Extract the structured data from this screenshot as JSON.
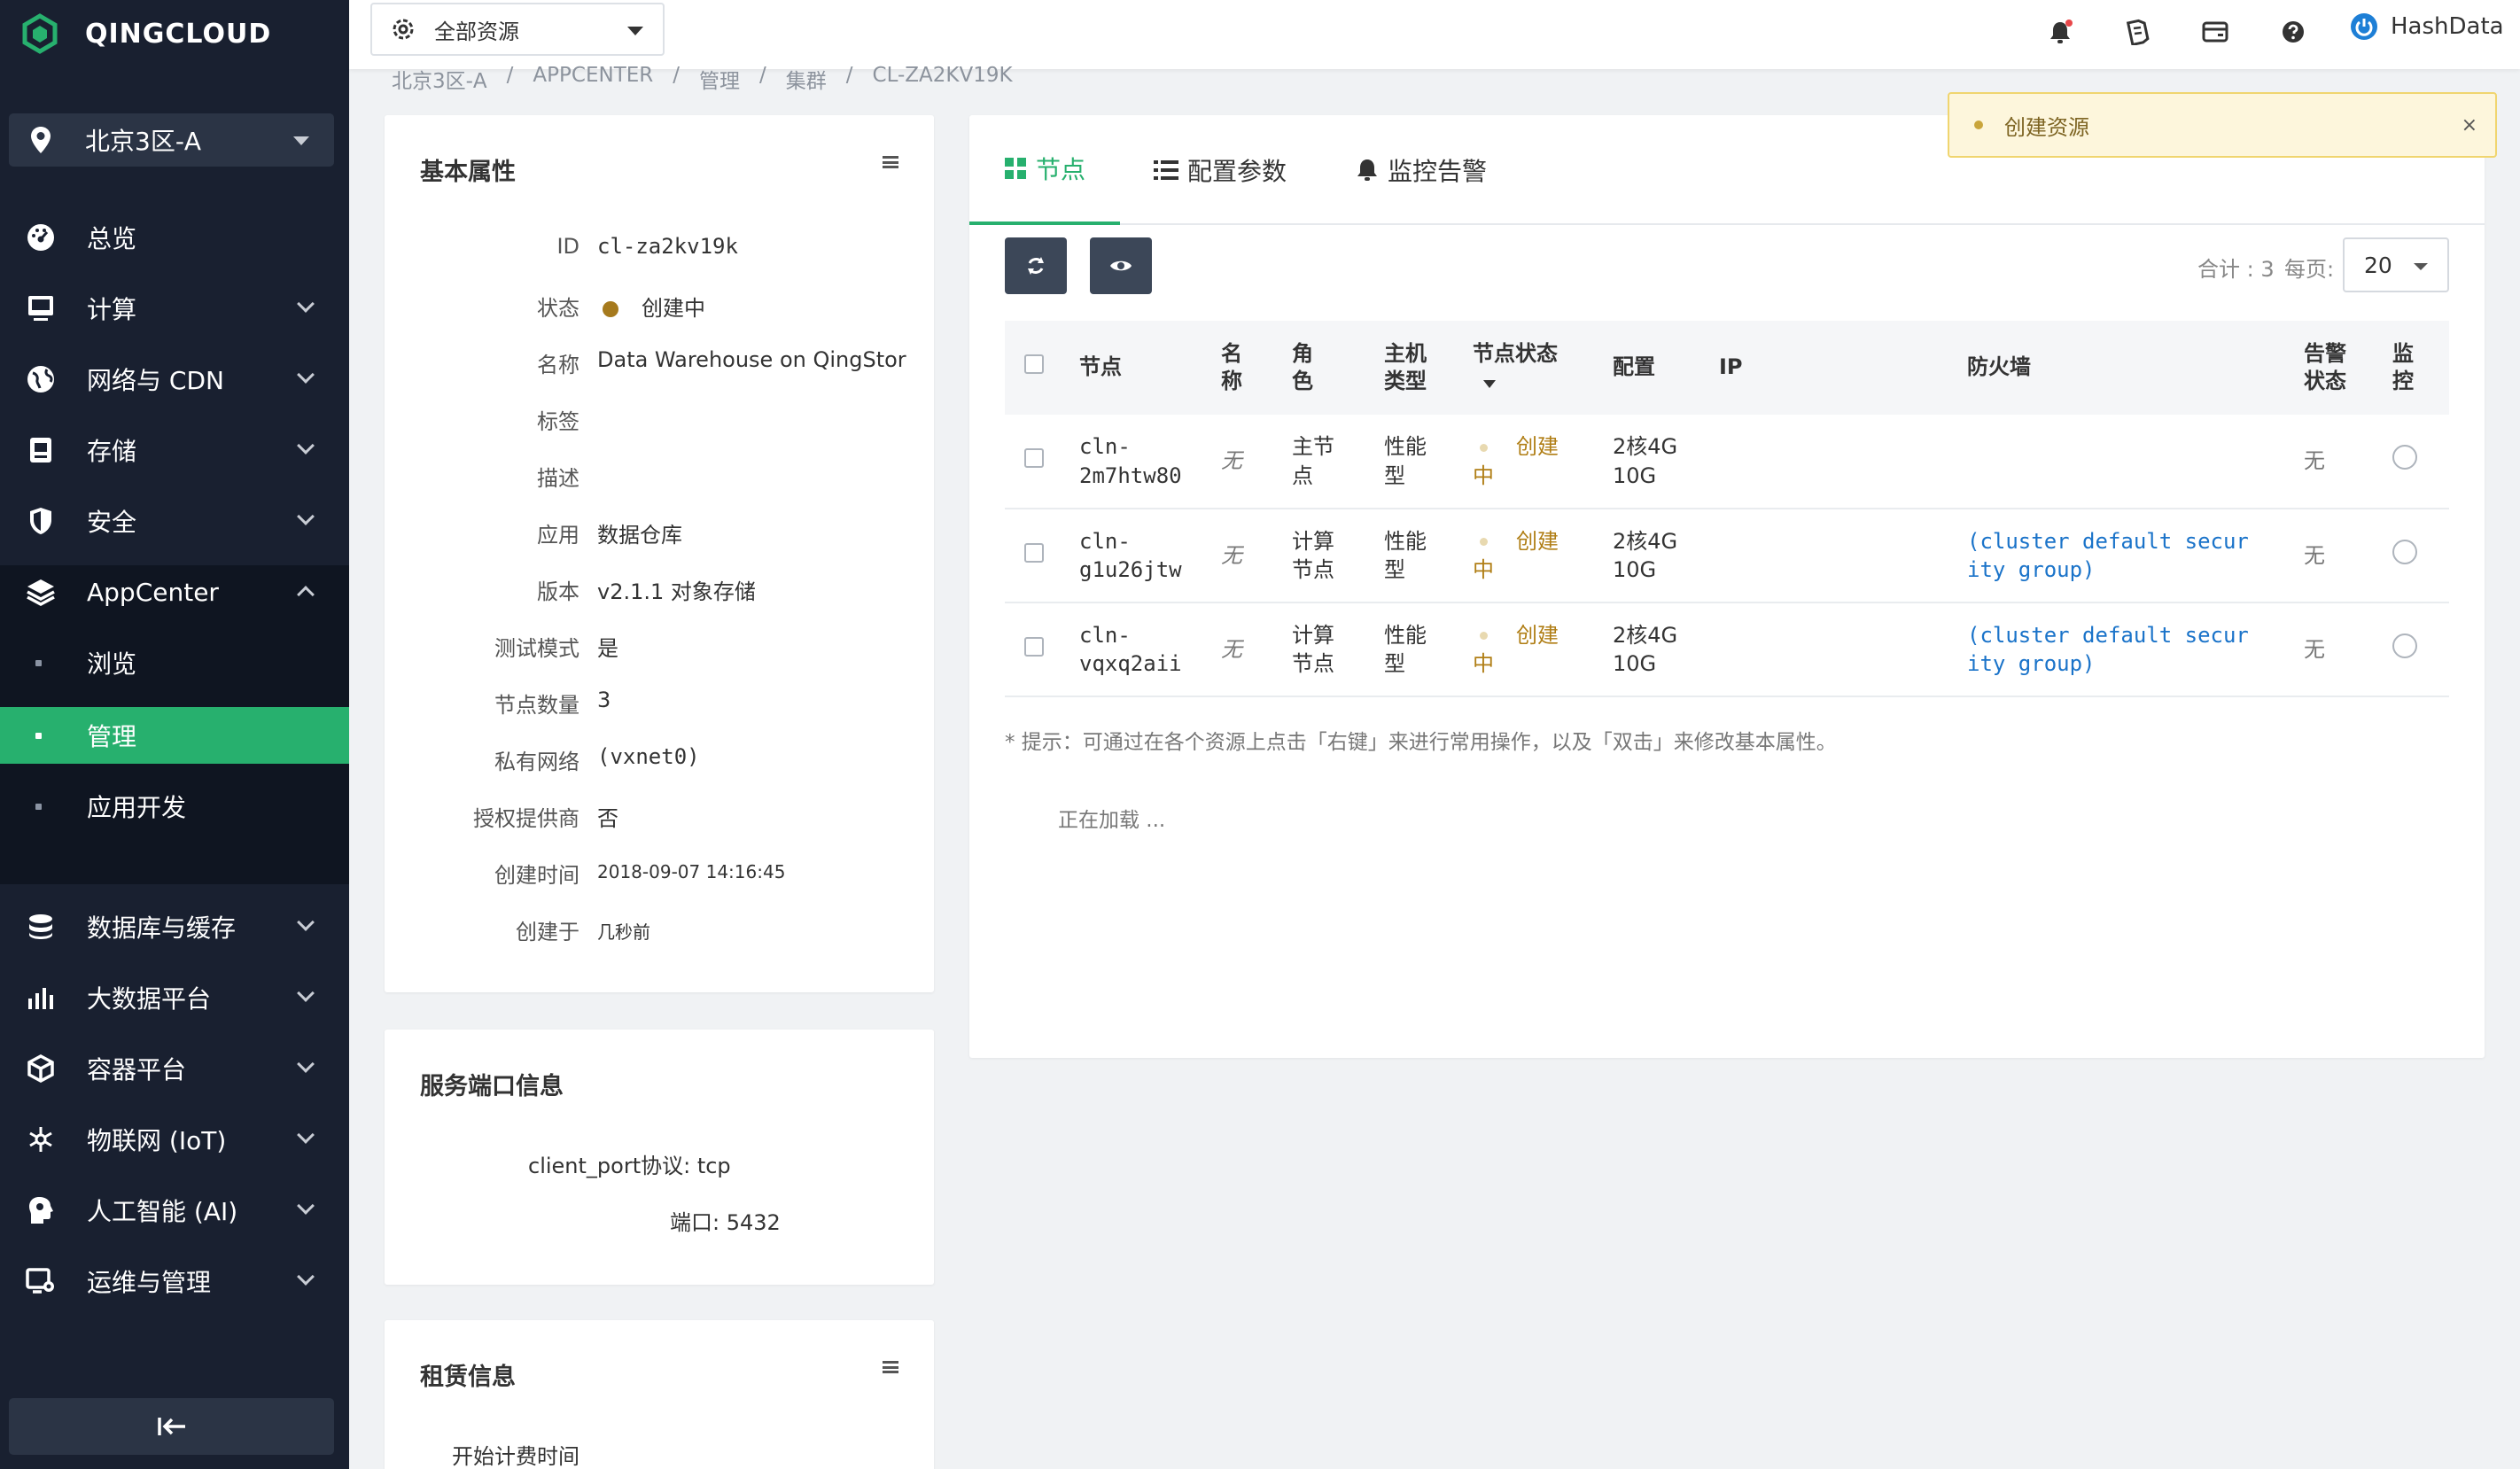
{
  "sidebar": {
    "brand": "QINGCLOUD",
    "zone": "北京3区-A",
    "items": [
      {
        "label": "总览",
        "icon": "dashboard-icon"
      },
      {
        "label": "计算",
        "icon": "monitor-icon"
      },
      {
        "label": "网络与 CDN",
        "icon": "globe-icon"
      },
      {
        "label": "存储",
        "icon": "storage-icon"
      },
      {
        "label": "安全",
        "icon": "shield-icon"
      },
      {
        "label": "AppCenter",
        "icon": "layers-icon"
      }
    ],
    "appcenter_sub": [
      {
        "label": "浏览"
      },
      {
        "label": "管理"
      },
      {
        "label": "应用开发"
      }
    ],
    "items2": [
      {
        "label": "数据库与缓存",
        "icon": "database-icon"
      },
      {
        "label": "大数据平台",
        "icon": "bar-chart-icon"
      },
      {
        "label": "容器平台",
        "icon": "cube-icon"
      },
      {
        "label": "物联网 (IoT)",
        "icon": "snowflake-icon"
      },
      {
        "label": "人工智能 (AI)",
        "icon": "ai-head-icon"
      },
      {
        "label": "运维与管理",
        "icon": "ops-icon"
      }
    ]
  },
  "topbar": {
    "resource_select": "全部资源",
    "user": "HashData"
  },
  "breadcrumb": [
    "北京3区-A",
    "/",
    "APPCENTER",
    "/",
    "管理",
    "/",
    "集群",
    "/",
    "CL-ZA2KV19K"
  ],
  "basic": {
    "title": "基本属性",
    "props": [
      {
        "k": "ID",
        "v": "cl-za2kv19k"
      },
      {
        "k": "状态",
        "v": "创建中"
      },
      {
        "k": "名称",
        "v": "Data Warehouse on QingStor"
      },
      {
        "k": "标签",
        "v": ""
      },
      {
        "k": "描述",
        "v": ""
      },
      {
        "k": "应用",
        "v": "数据仓库"
      },
      {
        "k": "版本",
        "v": "v2.1.1 对象存储"
      },
      {
        "k": "测试模式",
        "v": "是"
      },
      {
        "k": "节点数量",
        "v": "3"
      },
      {
        "k": "私有网络",
        "v": "(vxnet0)"
      },
      {
        "k": "授权提供商",
        "v": "否"
      },
      {
        "k": "创建时间",
        "v": "2018-09-07 14:16:45"
      },
      {
        "k": "创建于",
        "v": "几秒前"
      }
    ]
  },
  "service": {
    "title": "服务端口信息",
    "line1": "client_port协议: tcp",
    "line2": "端口: 5432"
  },
  "lease": {
    "title": "租赁信息",
    "line1": "开始计费时间"
  },
  "tabs": [
    "节点",
    "配置参数",
    "监控告警"
  ],
  "pager": {
    "total": "合计 : 3",
    "per_page_label": "每页:",
    "per_page": "20"
  },
  "table": {
    "headers": {
      "node": "节点",
      "name1": "名",
      "name2": "称",
      "role1": "角",
      "role2": "色",
      "host1": "主机",
      "host2": "类型",
      "status": "节点状态",
      "config": "配置",
      "ip": "IP",
      "firewall": "防火墙",
      "alarm1": "告警",
      "alarm2": "状态",
      "mon1": "监",
      "mon2": "控"
    },
    "rows": [
      {
        "node1": "cln-",
        "node2": "2m7htw80",
        "name": "无",
        "role1": "主节",
        "role2": "点",
        "host1": "性能",
        "host2": "型",
        "status1": "创建",
        "status2": "中",
        "cfg1": "2核4G",
        "cfg2": "10G",
        "fw1": "",
        "fw2": "",
        "alarm": "无"
      },
      {
        "node1": "cln-",
        "node2": "g1u26jtw",
        "name": "无",
        "role1": "计算",
        "role2": "节点",
        "host1": "性能",
        "host2": "型",
        "status1": "创建",
        "status2": "中",
        "cfg1": "2核4G",
        "cfg2": "10G",
        "fw1": "(cluster default secur",
        "fw2": "ity group)",
        "alarm": "无"
      },
      {
        "node1": "cln-",
        "node2": "vqxq2aii",
        "name": "无",
        "role1": "计算",
        "role2": "节点",
        "host1": "性能",
        "host2": "型",
        "status1": "创建",
        "status2": "中",
        "cfg1": "2核4G",
        "cfg2": "10G",
        "fw1": "(cluster default secur",
        "fw2": "ity group)",
        "alarm": "无"
      }
    ]
  },
  "hint": "* 提示：可通过在各个资源上点击「右键」来进行常用操作，以及「双击」来修改基本属性。",
  "loading": "正在加载 ...",
  "toast": {
    "text": "创建资源",
    "close": "×"
  },
  "colors": {
    "accent": "#27b06e",
    "sidebar": "#192030",
    "link": "#1a73c9",
    "pending": "#b07e15"
  }
}
